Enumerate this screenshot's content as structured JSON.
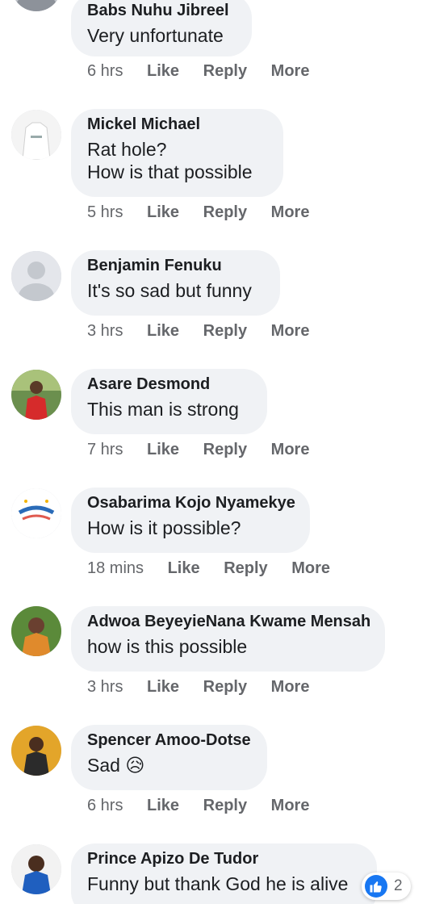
{
  "actions": {
    "like": "Like",
    "reply": "Reply",
    "more": "More"
  },
  "comments": [
    {
      "name": "Babs Nuhu Jibreel",
      "text": "Very unfortunate",
      "time": "6 hrs",
      "avatar": "avatar-photo"
    },
    {
      "name": "Mickel Michael",
      "text": "Rat hole?\nHow is that possible",
      "time": "5 hrs",
      "avatar": "jersey-photo"
    },
    {
      "name": "Benjamin Fenuku",
      "text": "It's so sad but funny",
      "time": "3 hrs",
      "avatar": "default-avatar"
    },
    {
      "name": "Asare Desmond",
      "text": "This man is strong",
      "time": "7 hrs",
      "avatar": "red-shirt-photo"
    },
    {
      "name": "Osabarima Kojo Nyamekye",
      "text": "How is it possible?",
      "time": "18 mins",
      "avatar": "fathers-day-photo"
    },
    {
      "name": "Adwoa BeyeyieNana Kwame Mensah",
      "text": "how is this possible",
      "time": "3 hrs",
      "avatar": "woman-photo"
    },
    {
      "name": "Spencer Amoo-Dotse",
      "text": "Sad 😥",
      "time": "6 hrs",
      "avatar": "man-photo"
    },
    {
      "name": "Prince Apizo De Tudor",
      "text": "Funny but thank God he is alive",
      "time": "",
      "avatar": "man-blue-photo"
    }
  ],
  "last_comment_reactions": {
    "type": "like",
    "count": "2",
    "color": "#1877f2"
  },
  "colors": {
    "bubble": "#f0f2f5",
    "meta_text": "#65676b",
    "name_text": "#1c1e21"
  }
}
